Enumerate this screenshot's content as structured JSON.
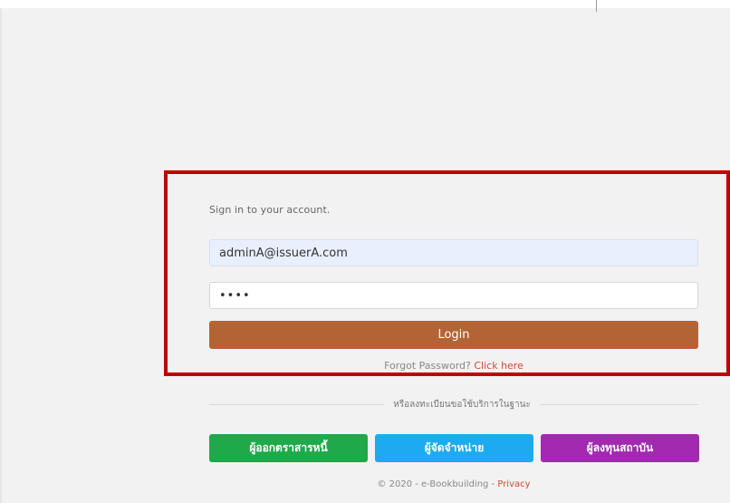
{
  "login": {
    "prompt": "Sign in to your account.",
    "email_value": "adminA@issuerA.com",
    "password_value": "1234",
    "login_label": "Login",
    "forgot_text": "Forgot Password?",
    "forgot_link": "Click here"
  },
  "register": {
    "divider_text": "หรือลงทะเบียนขอใช้บริการในฐานะ",
    "roles": [
      {
        "label": "ผู้ออกตราสารหนี้",
        "color": "#1fa94a"
      },
      {
        "label": "ผู้จัดจำหน่าย",
        "color": "#1eaaf0"
      },
      {
        "label": "ผู้ลงทุนสถาบัน",
        "color": "#a12ab0"
      }
    ]
  },
  "footer": {
    "copyright": "© 2020 - e-Bookbuilding - ",
    "privacy_label": "Privacy"
  },
  "colors": {
    "login_button": "#b46434",
    "highlight_border": "#c00000",
    "link": "#cf4b33"
  }
}
